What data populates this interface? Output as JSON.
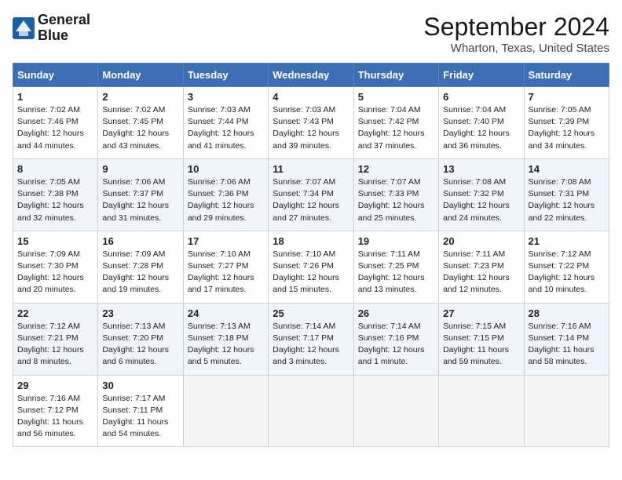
{
  "header": {
    "logo_line1": "General",
    "logo_line2": "Blue",
    "month_title": "September 2024",
    "location": "Wharton, Texas, United States"
  },
  "days_of_week": [
    "Sunday",
    "Monday",
    "Tuesday",
    "Wednesday",
    "Thursday",
    "Friday",
    "Saturday"
  ],
  "weeks": [
    [
      {
        "day": "1",
        "rise": "7:02 AM",
        "set": "7:46 PM",
        "daylight": "12 hours and 44 minutes."
      },
      {
        "day": "2",
        "rise": "7:02 AM",
        "set": "7:45 PM",
        "daylight": "12 hours and 43 minutes."
      },
      {
        "day": "3",
        "rise": "7:03 AM",
        "set": "7:44 PM",
        "daylight": "12 hours and 41 minutes."
      },
      {
        "day": "4",
        "rise": "7:03 AM",
        "set": "7:43 PM",
        "daylight": "12 hours and 39 minutes."
      },
      {
        "day": "5",
        "rise": "7:04 AM",
        "set": "7:42 PM",
        "daylight": "12 hours and 37 minutes."
      },
      {
        "day": "6",
        "rise": "7:04 AM",
        "set": "7:40 PM",
        "daylight": "12 hours and 36 minutes."
      },
      {
        "day": "7",
        "rise": "7:05 AM",
        "set": "7:39 PM",
        "daylight": "12 hours and 34 minutes."
      }
    ],
    [
      {
        "day": "8",
        "rise": "7:05 AM",
        "set": "7:38 PM",
        "daylight": "12 hours and 32 minutes."
      },
      {
        "day": "9",
        "rise": "7:06 AM",
        "set": "7:37 PM",
        "daylight": "12 hours and 31 minutes."
      },
      {
        "day": "10",
        "rise": "7:06 AM",
        "set": "7:36 PM",
        "daylight": "12 hours and 29 minutes."
      },
      {
        "day": "11",
        "rise": "7:07 AM",
        "set": "7:34 PM",
        "daylight": "12 hours and 27 minutes."
      },
      {
        "day": "12",
        "rise": "7:07 AM",
        "set": "7:33 PM",
        "daylight": "12 hours and 25 minutes."
      },
      {
        "day": "13",
        "rise": "7:08 AM",
        "set": "7:32 PM",
        "daylight": "12 hours and 24 minutes."
      },
      {
        "day": "14",
        "rise": "7:08 AM",
        "set": "7:31 PM",
        "daylight": "12 hours and 22 minutes."
      }
    ],
    [
      {
        "day": "15",
        "rise": "7:09 AM",
        "set": "7:30 PM",
        "daylight": "12 hours and 20 minutes."
      },
      {
        "day": "16",
        "rise": "7:09 AM",
        "set": "7:28 PM",
        "daylight": "12 hours and 19 minutes."
      },
      {
        "day": "17",
        "rise": "7:10 AM",
        "set": "7:27 PM",
        "daylight": "12 hours and 17 minutes."
      },
      {
        "day": "18",
        "rise": "7:10 AM",
        "set": "7:26 PM",
        "daylight": "12 hours and 15 minutes."
      },
      {
        "day": "19",
        "rise": "7:11 AM",
        "set": "7:25 PM",
        "daylight": "12 hours and 13 minutes."
      },
      {
        "day": "20",
        "rise": "7:11 AM",
        "set": "7:23 PM",
        "daylight": "12 hours and 12 minutes."
      },
      {
        "day": "21",
        "rise": "7:12 AM",
        "set": "7:22 PM",
        "daylight": "12 hours and 10 minutes."
      }
    ],
    [
      {
        "day": "22",
        "rise": "7:12 AM",
        "set": "7:21 PM",
        "daylight": "12 hours and 8 minutes."
      },
      {
        "day": "23",
        "rise": "7:13 AM",
        "set": "7:20 PM",
        "daylight": "12 hours and 6 minutes."
      },
      {
        "day": "24",
        "rise": "7:13 AM",
        "set": "7:18 PM",
        "daylight": "12 hours and 5 minutes."
      },
      {
        "day": "25",
        "rise": "7:14 AM",
        "set": "7:17 PM",
        "daylight": "12 hours and 3 minutes."
      },
      {
        "day": "26",
        "rise": "7:14 AM",
        "set": "7:16 PM",
        "daylight": "12 hours and 1 minute."
      },
      {
        "day": "27",
        "rise": "7:15 AM",
        "set": "7:15 PM",
        "daylight": "11 hours and 59 minutes."
      },
      {
        "day": "28",
        "rise": "7:16 AM",
        "set": "7:14 PM",
        "daylight": "11 hours and 58 minutes."
      }
    ],
    [
      {
        "day": "29",
        "rise": "7:16 AM",
        "set": "7:12 PM",
        "daylight": "11 hours and 56 minutes."
      },
      {
        "day": "30",
        "rise": "7:17 AM",
        "set": "7:11 PM",
        "daylight": "11 hours and 54 minutes."
      },
      null,
      null,
      null,
      null,
      null
    ]
  ],
  "labels": {
    "sunrise": "Sunrise:",
    "sunset": "Sunset:",
    "daylight": "Daylight:"
  }
}
